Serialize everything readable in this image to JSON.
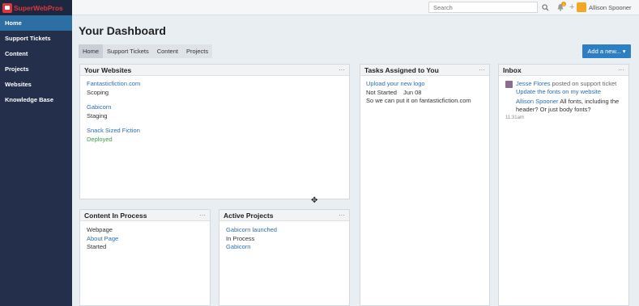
{
  "brand": {
    "name": "SuperWebPros"
  },
  "sidebar": {
    "items": [
      {
        "label": "Home"
      },
      {
        "label": "Support Tickets"
      },
      {
        "label": "Content"
      },
      {
        "label": "Projects"
      },
      {
        "label": "Websites"
      },
      {
        "label": "Knowledge Base"
      }
    ]
  },
  "topbar": {
    "search_placeholder": "Search",
    "notification_count": "3",
    "user_name": "Allison Spooner"
  },
  "page": {
    "title": "Your Dashboard",
    "tabs": [
      {
        "label": "Home"
      },
      {
        "label": "Support Tickets"
      },
      {
        "label": "Content"
      },
      {
        "label": "Projects"
      }
    ],
    "add_button": "Add a new..."
  },
  "panels": {
    "websites": {
      "title": "Your Websites",
      "items": [
        {
          "name": "Fantasticfiction.com",
          "status": "Scoping"
        },
        {
          "name": "Gabicorn",
          "status": "Staging"
        },
        {
          "name": "Snack Sized Fiction",
          "status": "Deployed"
        }
      ]
    },
    "tasks": {
      "title": "Tasks Assigned to You",
      "item": {
        "title": "Upload your new logo",
        "status": "Not Started",
        "date": "Jun 08",
        "description": "So we can put it on fantasticfiction.com"
      }
    },
    "inbox": {
      "title": "Inbox",
      "item": {
        "author": "Jesse Flores",
        "action": "posted on support ticket",
        "ticket": "Update the fonts on my website",
        "replier": "Allison Spooner",
        "message": "All fonts, including the header? Or just body fonts?",
        "time": "11:31am"
      }
    },
    "content": {
      "title": "Content In Process",
      "type": "Webpage",
      "page": "About Page",
      "status": "Started"
    },
    "projects": {
      "title": "Active Projects",
      "name": "Gabicorn launched",
      "status": "In Process",
      "site": "Gabicorn"
    }
  },
  "colors": {
    "sidebar": "#232f4b",
    "accent": "#2d7fc1",
    "brand": "#e0353c",
    "link": "#2a6fb5",
    "deployed": "#3aa04a"
  }
}
